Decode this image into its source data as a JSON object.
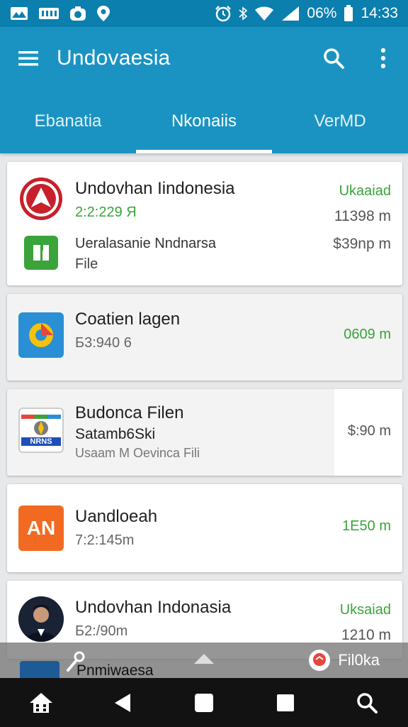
{
  "status_bar": {
    "battery": "06%",
    "time": "14:33"
  },
  "app_bar": {
    "title": "Undovaesia"
  },
  "tabs": [
    {
      "label": "Ebanatia",
      "active": false
    },
    {
      "label": "Nkonaiis",
      "active": true
    },
    {
      "label": "VerMD",
      "active": false
    }
  ],
  "items": [
    {
      "icon": "red-circle-logo-icon",
      "title": "Undovhan Iindonesia",
      "subtitle": "2:2:229 Я",
      "meta_top": "Ukaaiad",
      "meta_bottom": "11398 m",
      "second_icon": "green-file-icon",
      "second_title": "Ueralasanie Nndnarsa",
      "second_sub": "File",
      "second_meta": "$39np m"
    },
    {
      "icon": "blue-app-icon",
      "title": "Coatien lagen",
      "subtitle": "Б3:940 6",
      "meta": "0609 m"
    },
    {
      "icon": "nrns-card-icon",
      "title": "Budonca Filen",
      "subtitle": "Satamb6Ski",
      "subtitle2": "Usaam M Oevinca Fili",
      "meta": "$:90 m",
      "icon_label": "NRNS"
    },
    {
      "icon": "orange-an-icon",
      "title": "Uandloeah",
      "subtitle": "7:2:145m",
      "meta": "1E50 m",
      "icon_label": "AN"
    },
    {
      "icon": "avatar-icon",
      "title": "Undovhan Indonasia",
      "subtitle": "Б2:/90m",
      "meta_top": "Uksaiad",
      "meta_bottom": "1210 m"
    }
  ],
  "overlay": {
    "peek_title": "Pnmiwaesa",
    "action_label": "Fil0ka"
  },
  "colors": {
    "status_bar": "#0b7fae",
    "app_bar": "#1a93c3",
    "accent_green": "#3aa33a"
  }
}
